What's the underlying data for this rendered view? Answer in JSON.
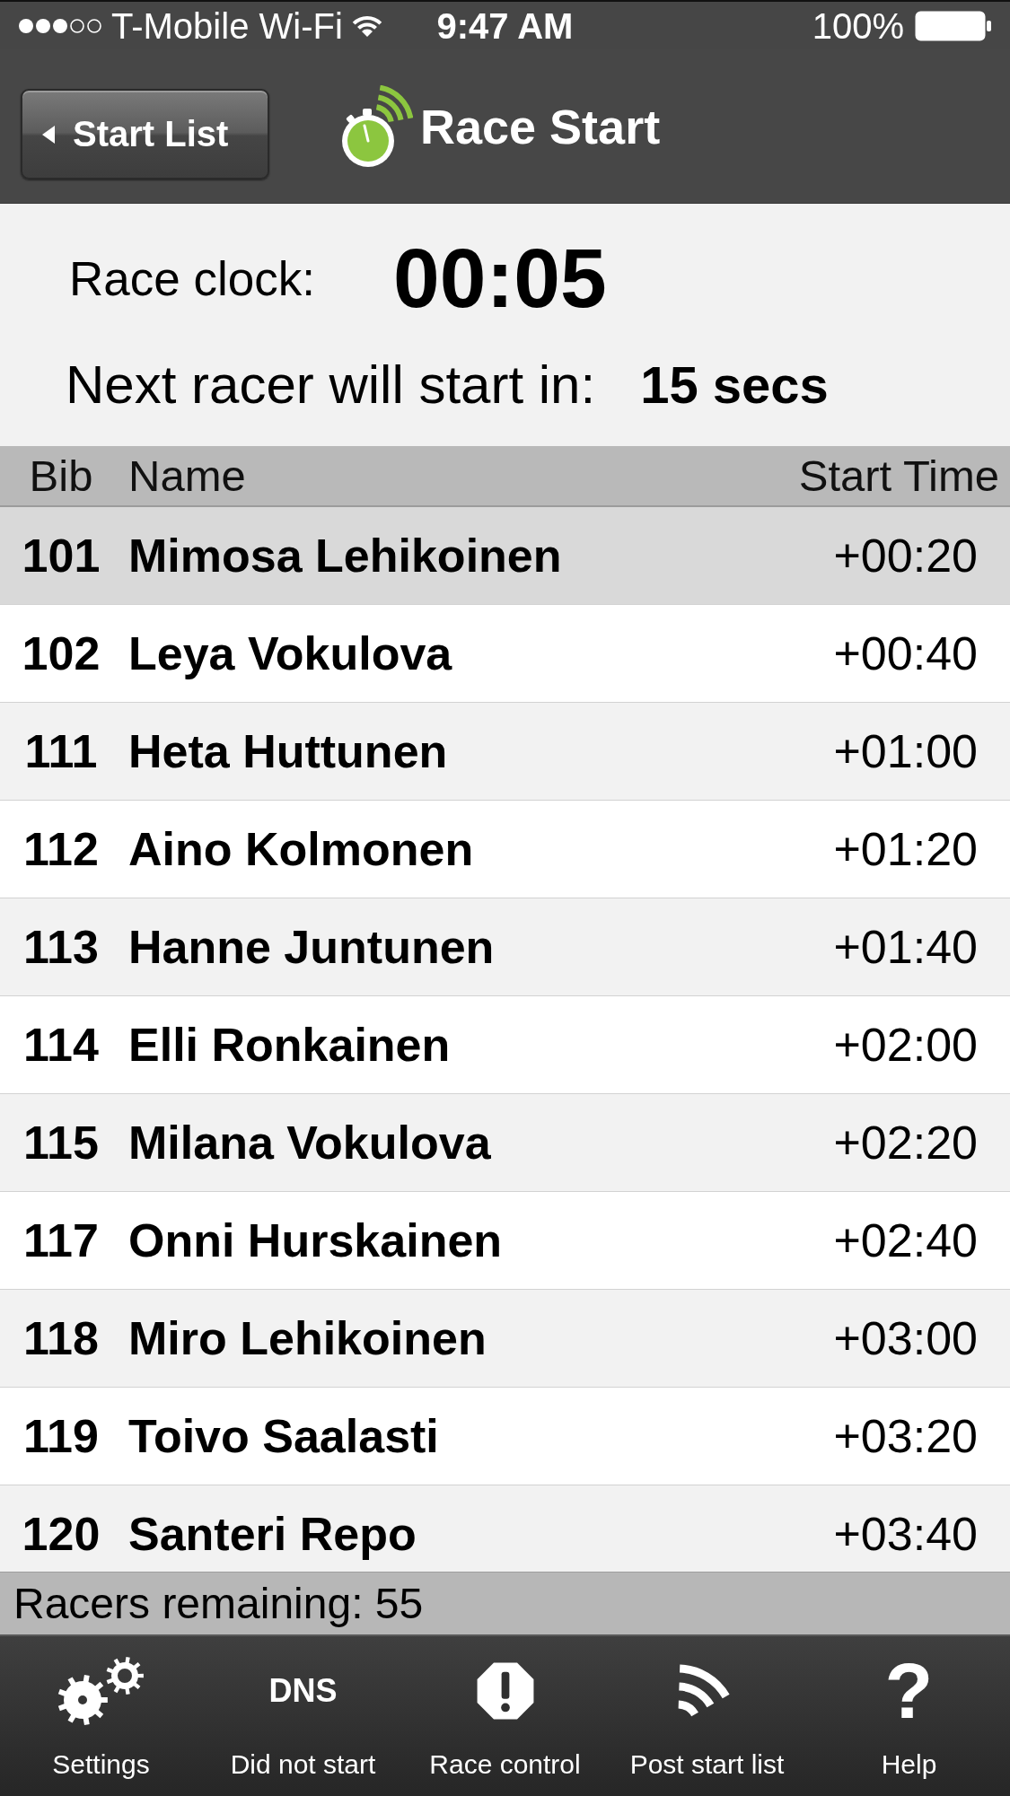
{
  "status_bar": {
    "carrier": "T-Mobile Wi-Fi",
    "time": "9:47 AM",
    "battery": "100%"
  },
  "nav_bar": {
    "back_button": "Start List",
    "title": "Race Start"
  },
  "race_info": {
    "clock_label": "Race clock:",
    "clock_value": "00:05",
    "next_label": "Next racer will start in:",
    "next_value": "15 secs"
  },
  "table": {
    "columns": [
      "Bib",
      "Name",
      "Start Time"
    ],
    "rows": [
      {
        "bib": "101",
        "name": "Mimosa Lehikoinen",
        "start_time": "+00:20",
        "selected": true
      },
      {
        "bib": "102",
        "name": "Leya Vokulova",
        "start_time": "+00:40",
        "selected": false
      },
      {
        "bib": "111",
        "name": "Heta Huttunen",
        "start_time": "+01:00",
        "selected": false
      },
      {
        "bib": "112",
        "name": "Aino Kolmonen",
        "start_time": "+01:20",
        "selected": false
      },
      {
        "bib": "113",
        "name": "Hanne Juntunen",
        "start_time": "+01:40",
        "selected": false
      },
      {
        "bib": "114",
        "name": "Elli Ronkainen",
        "start_time": "+02:00",
        "selected": false
      },
      {
        "bib": "115",
        "name": "Milana Vokulova",
        "start_time": "+02:20",
        "selected": false
      },
      {
        "bib": "117",
        "name": "Onni Hurskainen",
        "start_time": "+02:40",
        "selected": false
      },
      {
        "bib": "118",
        "name": "Miro Lehikoinen",
        "start_time": "+03:00",
        "selected": false
      },
      {
        "bib": "119",
        "name": "Toivo Saalasti",
        "start_time": "+03:20",
        "selected": false
      },
      {
        "bib": "120",
        "name": "Santeri Repo",
        "start_time": "+03:40",
        "selected": false
      }
    ]
  },
  "footer": {
    "text": "Racers remaining: 55"
  },
  "toolbar": {
    "items": [
      {
        "kind": "gears",
        "label": "Settings"
      },
      {
        "kind": "dns",
        "glyph": "DNS",
        "label": "Did not start"
      },
      {
        "kind": "alert",
        "label": "Race control"
      },
      {
        "kind": "waves",
        "label": "Post start list"
      },
      {
        "kind": "question",
        "glyph": "?",
        "label": "Help"
      }
    ]
  }
}
